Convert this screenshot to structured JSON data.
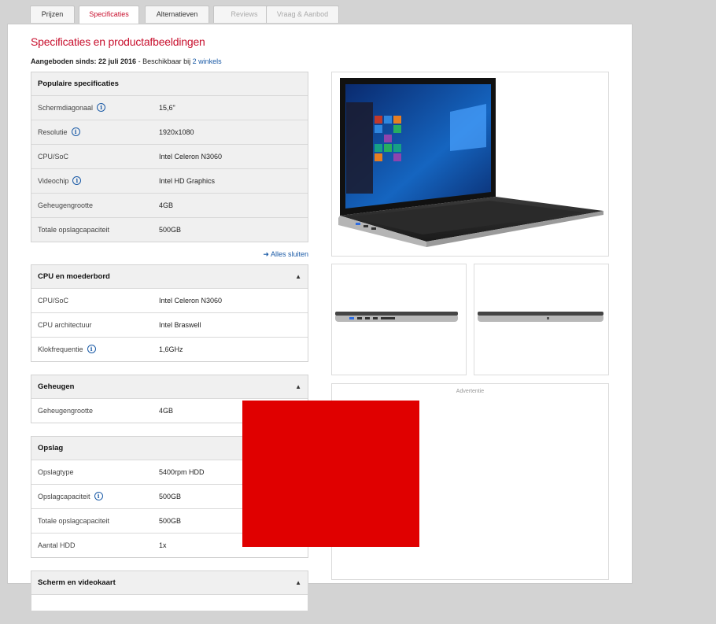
{
  "tabs": [
    {
      "label": "Prijzen",
      "state": "normal"
    },
    {
      "label": "Specificaties",
      "state": "active"
    },
    {
      "label": "Alternatieven",
      "state": "normal"
    },
    {
      "label": "Reviews",
      "state": "disabled"
    },
    {
      "label": "Vraag & Aanbod",
      "state": "disabled"
    }
  ],
  "page": {
    "title": "Specificaties en productafbeeldingen",
    "offered_since_label": "Aangeboden sinds:",
    "offered_since_date": "22 juli 2016",
    "availability_prefix": " - Beschikbaar bij ",
    "shops_link": "2 winkels",
    "close_all": "Alles sluiten",
    "advertisement": "Advertentie"
  },
  "sections": {
    "popular": {
      "title": "Populaire specificaties",
      "rows": [
        {
          "label": "Schermdiagonaal",
          "value": "15,6\"",
          "info": true
        },
        {
          "label": "Resolutie",
          "value": "1920x1080",
          "info": true
        },
        {
          "label": "CPU/SoC",
          "value": "Intel Celeron N3060",
          "info": false
        },
        {
          "label": "Videochip",
          "value": "Intel HD Graphics",
          "info": true
        },
        {
          "label": "Geheugengrootte",
          "value": "4GB",
          "info": false
        },
        {
          "label": "Totale opslagcapaciteit",
          "value": "500GB",
          "info": false
        }
      ]
    },
    "cpu": {
      "title": "CPU en moederbord",
      "rows": [
        {
          "label": "CPU/SoC",
          "value": "Intel Celeron N3060",
          "info": false
        },
        {
          "label": "CPU architectuur",
          "value": "Intel Braswell",
          "info": false
        },
        {
          "label": "Klokfrequentie",
          "value": "1,6GHz",
          "info": true
        }
      ]
    },
    "memory": {
      "title": "Geheugen",
      "rows": [
        {
          "label": "Geheugengrootte",
          "value": "4GB",
          "info": false
        }
      ]
    },
    "storage": {
      "title": "Opslag",
      "rows": [
        {
          "label": "Opslagtype",
          "value": "5400rpm HDD",
          "info": false
        },
        {
          "label": "Opslagcapaciteit",
          "value": "500GB",
          "info": true
        },
        {
          "label": "Totale opslagcapaciteit",
          "value": "500GB",
          "info": false
        },
        {
          "label": "Aantal HDD",
          "value": "1x",
          "info": false
        }
      ]
    },
    "screen": {
      "title": "Scherm en videokaart"
    }
  },
  "colors": {
    "accent": "#c8102e",
    "link": "#1a5aa6",
    "overlay_red": "#e00000"
  },
  "icons": {
    "info": "info-icon",
    "collapse": "chevron-up-icon",
    "close_all": "arrow-right-icon"
  }
}
